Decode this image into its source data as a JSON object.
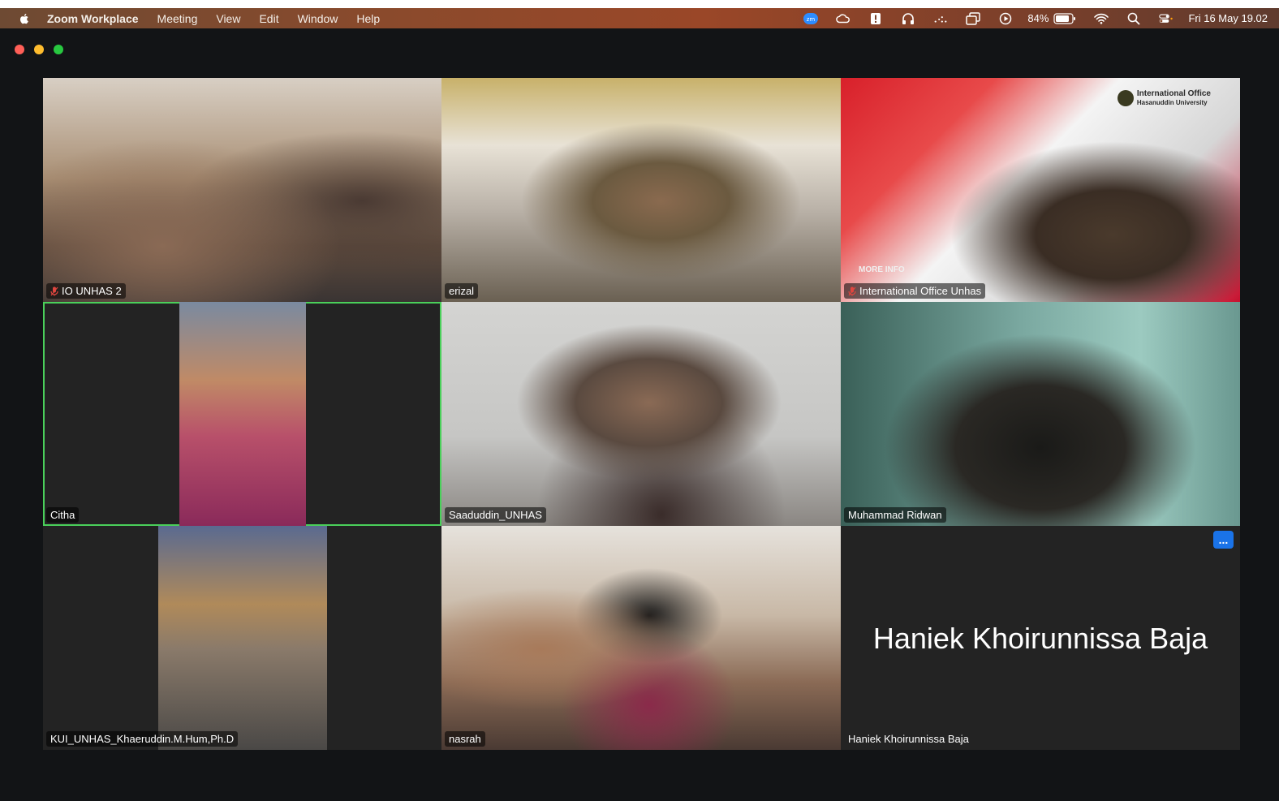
{
  "menubar": {
    "app": "Zoom Workplace",
    "items": [
      "Meeting",
      "View",
      "Edit",
      "Window",
      "Help"
    ],
    "battery": "84%",
    "datetime": "Fri 16 May  19.02",
    "icons": [
      "zoom-icon",
      "creative-cloud-icon",
      "alert-icon",
      "headphones-icon",
      "dots-icon",
      "window-icon",
      "play-icon",
      "battery-icon",
      "wifi-icon",
      "search-icon",
      "control-center-icon"
    ]
  },
  "window": {
    "lights": [
      "#ff5f57",
      "#febc2e",
      "#28c840"
    ]
  },
  "participants": [
    {
      "name": "IO UNHAS 2",
      "muted": true
    },
    {
      "name": "erizal",
      "muted": false
    },
    {
      "name": "International Office Unhas",
      "muted": true,
      "logo_title": "International Office",
      "logo_subtitle": "Hasanuddin University",
      "banner_text": "MORE INFO"
    },
    {
      "name": "Citha",
      "muted": false,
      "active_speaker": true
    },
    {
      "name": "Saaduddin_UNHAS",
      "muted": false
    },
    {
      "name": "Muhammad Ridwan",
      "muted": false
    },
    {
      "name": "KUI_UNHAS_Khaeruddin.M.Hum,Ph.D",
      "muted": false
    },
    {
      "name": "nasrah",
      "muted": false
    },
    {
      "name": "Haniek Khoirunnissa Baja",
      "muted": false,
      "video_off": true,
      "more_label": "..."
    }
  ]
}
